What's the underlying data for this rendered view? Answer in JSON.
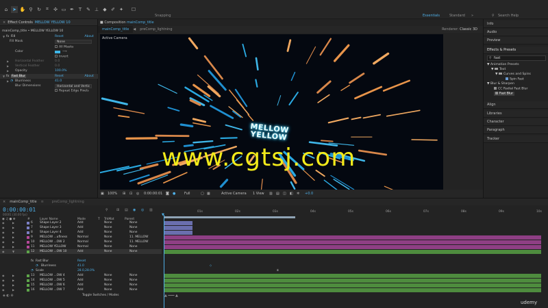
{
  "toolbar": {
    "snapping": "Snapping",
    "workspaces": [
      "Essentials",
      "Standard"
    ],
    "search_placeholder": "Search Help"
  },
  "effect_controls": {
    "tab_label": "Effect Controls",
    "tab_layer": "MELLOW YELLOW 10",
    "breadcrumb": "mainComp_title • MELLOW YELLOW 10",
    "fill": {
      "name": "Fill",
      "reset": "Reset",
      "about": "About",
      "fill_mask_label": "Fill Mask",
      "fill_mask_value": "None",
      "all_masks": "All Masks",
      "color_label": "Color",
      "color_hex": "#3fb6e8",
      "invert": "Invert",
      "h_feather_label": "Horizontal Feather",
      "h_feather_value": "0.0",
      "v_feather_label": "Vertical Feather",
      "v_feather_value": "0.0",
      "opacity_label": "Opacity",
      "opacity_value": "100.0%"
    },
    "fast_blur": {
      "name": "Fast Blur",
      "reset": "Reset",
      "about": "About",
      "blurriness_label": "Blurriness",
      "blurriness_value": "41.0",
      "dimensions_label": "Blur Dimensions",
      "dimensions_value": "Horizontal and Vertic",
      "repeat": "Repeat Edge Pixels"
    }
  },
  "composition": {
    "panel_label": "Composition",
    "panel_comp": "mainComp_title",
    "tabs": [
      "mainComp_title",
      "preComp_lightning"
    ],
    "renderer_label": "Renderer:",
    "renderer_value": "Classic 3D",
    "active_camera": "Active Camera",
    "title_line1": "MELLOW",
    "title_line2": "YELLOW",
    "bottom": {
      "zoom": "100%",
      "time": "0:00:00:01",
      "resolution": "Full",
      "camera": "Active Camera",
      "views": "1 View",
      "exposure": "+0.0"
    }
  },
  "watermark": "www.cgtsj.com",
  "right_panels": {
    "info": "Info",
    "audio": "Audio",
    "preview": "Preview",
    "effects_presets": "Effects & Presets",
    "search_value": "fast",
    "tree": {
      "animation_presets": "Animation Presets",
      "text": "Text",
      "curves_spins": "Curves and Spins",
      "spin_fast": "Spin Fast",
      "blur_sharpen": "Blur & Sharpen",
      "cc_radial": "CC Radial Fast Blur",
      "fast_blur": "Fast Blur"
    },
    "align": "Align",
    "libraries": "Libraries",
    "character": "Character",
    "paragraph": "Paragraph",
    "tracker": "Tracker"
  },
  "timeline": {
    "tabs": [
      "mainComp_title",
      "preComp_lightning"
    ],
    "timecode": "0:00:00:01",
    "framerate": "00001 (30.00 fps)",
    "columns": {
      "layer_name": "Layer Name",
      "mode": "Mode",
      "t": "T",
      "trkmat": "TrkMat",
      "parent": "Parent"
    },
    "ruler_labels": [
      "01s",
      "02s",
      "03s",
      "04s",
      "05s",
      "06s",
      "07s",
      "08s",
      "09s",
      "10s"
    ],
    "layers": [
      {
        "num": "6",
        "name": "Shape Layer 2",
        "mode": "Add",
        "trk": "None",
        "parent": "None",
        "color": "#7b7fc4"
      },
      {
        "num": "7",
        "name": "Shape Layer 3",
        "mode": "Add",
        "trk": "None",
        "parent": "None",
        "color": "#7b7fc4"
      },
      {
        "num": "8",
        "name": "Shape Layer 4",
        "mode": "Add",
        "trk": "None",
        "parent": "None",
        "color": "#7b7fc4"
      },
      {
        "num": "9",
        "name": "MELLOW ...ufiness",
        "mode": "Normal",
        "trk": "None",
        "parent": "11. MELLOW",
        "color": "#b4479a"
      },
      {
        "num": "10",
        "name": "MELLOW ...OW 2",
        "mode": "Normal",
        "trk": "None",
        "parent": "11. MELLOW",
        "color": "#b4479a"
      },
      {
        "num": "11",
        "name": "MELLOW YELLOW",
        "mode": "Normal",
        "trk": "None",
        "parent": "None",
        "color": "#b4479a"
      },
      {
        "num": "12",
        "name": "MELLOW ...OW 10",
        "mode": "Add",
        "trk": "None",
        "parent": "None",
        "color": "#5ea64a"
      }
    ],
    "sub_rows": {
      "fast_blur": "Fast Blur",
      "fast_blur_reset": "Reset",
      "blurriness": "Blurriness",
      "blurriness_value": "41.0",
      "scale": "Scale",
      "scale_value": "28.0,28.0%"
    },
    "layers_lower": [
      {
        "num": "13",
        "name": "MELLOW ...OW 4",
        "mode": "Add",
        "trk": "None",
        "parent": "None",
        "color": "#5ea64a"
      },
      {
        "num": "14",
        "name": "MELLOW ...OW 5",
        "mode": "Add",
        "trk": "None",
        "parent": "None",
        "color": "#5ea64a"
      },
      {
        "num": "15",
        "name": "MELLOW ...OW 6",
        "mode": "Add",
        "trk": "None",
        "parent": "None",
        "color": "#5ea64a"
      },
      {
        "num": "16",
        "name": "MELLOW ...OW 7",
        "mode": "Add",
        "trk": "None",
        "parent": "None",
        "color": "#5ea64a"
      }
    ],
    "footer": "Toggle Switches / Modes"
  },
  "brand": "udemy"
}
